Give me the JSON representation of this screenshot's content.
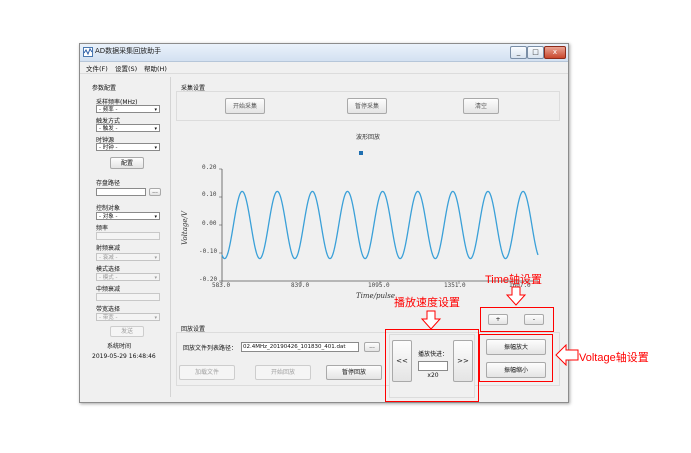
{
  "window": {
    "title": "AD数据采集回放助手",
    "controls": {
      "minimize": "_",
      "maximize": "□",
      "close": "x"
    }
  },
  "menu": [
    {
      "label": "文件(F)"
    },
    {
      "label": "设置(S)"
    },
    {
      "label": "帮助(H)"
    }
  ],
  "params_panel": {
    "title": "参数配置",
    "sample_rate": {
      "label": "采样频率(MHz)",
      "value": "- 频率 -"
    },
    "trigger": {
      "label": "触发方式",
      "value": "- 触发 -"
    },
    "clock": {
      "label": "时钟源",
      "value": "- 时钟 -"
    },
    "config_button": "配置",
    "save_path": {
      "label": "存盘路径",
      "value": "",
      "browse": "..."
    },
    "control_target": {
      "label": "控制对象",
      "value": "- 对象 -"
    },
    "frequency": {
      "label": "频率",
      "value": ""
    },
    "rf_attenuation": {
      "label": "射频衰减",
      "value": "- 衰减 -"
    },
    "mode": {
      "label": "模式选择",
      "value": "- 模式 -"
    },
    "if_attenuation": {
      "label": "中频衰减",
      "value": ""
    },
    "bandwidth": {
      "label": "带宽选择",
      "value": "- 带宽 -"
    },
    "send_button": "发送",
    "system_time": {
      "label": "系统时间",
      "value": "2019-05-29 16:48:46"
    }
  },
  "capture": {
    "title": "采集设置",
    "start_button": "开始采集",
    "pause_button": "暂停采集",
    "clear_button": "清空"
  },
  "chart_data": {
    "type": "line",
    "title": "波形回放",
    "xlabel": "Time/pulse",
    "ylabel": "Voltage/V",
    "xlim": [
      583.0,
      1607.0
    ],
    "ylim": [
      -0.2,
      0.2
    ],
    "x_ticks": [
      "583.0",
      "839.0",
      "1095.0",
      "1351.0",
      "1607.0"
    ],
    "y_ticks": [
      "0.20",
      "0.10",
      "0.00",
      "-0.10",
      "-0.20"
    ],
    "grid": false,
    "legend": "top-center",
    "series_color": "#3aa0d8",
    "series": [
      {
        "amplitude": 0.12,
        "cycles": 9,
        "x_start": 583.0,
        "x_end": 1607.0
      }
    ]
  },
  "playback": {
    "title": "回放设置",
    "file_list_label": "回放文件列表路径：",
    "file_path": "02.4MHz_20190426_101830_401.dat",
    "browse": "...",
    "load_button": "加载文件",
    "start_button": "开始回放",
    "pause_button": "暂停回放",
    "speed": {
      "label": "播放快进：",
      "value": "x20",
      "slower": "<<",
      "faster": ">>"
    }
  },
  "time_axis": {
    "plus": "+",
    "minus": "-"
  },
  "voltage_axis": {
    "zoom_in": "振幅放大",
    "zoom_out": "振幅缩小"
  },
  "annotations": {
    "time_axis_setting": "Time轴设置",
    "speed_setting": "播放速度设置",
    "voltage_axis_setting": "Voltage轴设置"
  },
  "colors": {
    "annotation": "#ff0000",
    "wave": "#3aa0d8"
  }
}
